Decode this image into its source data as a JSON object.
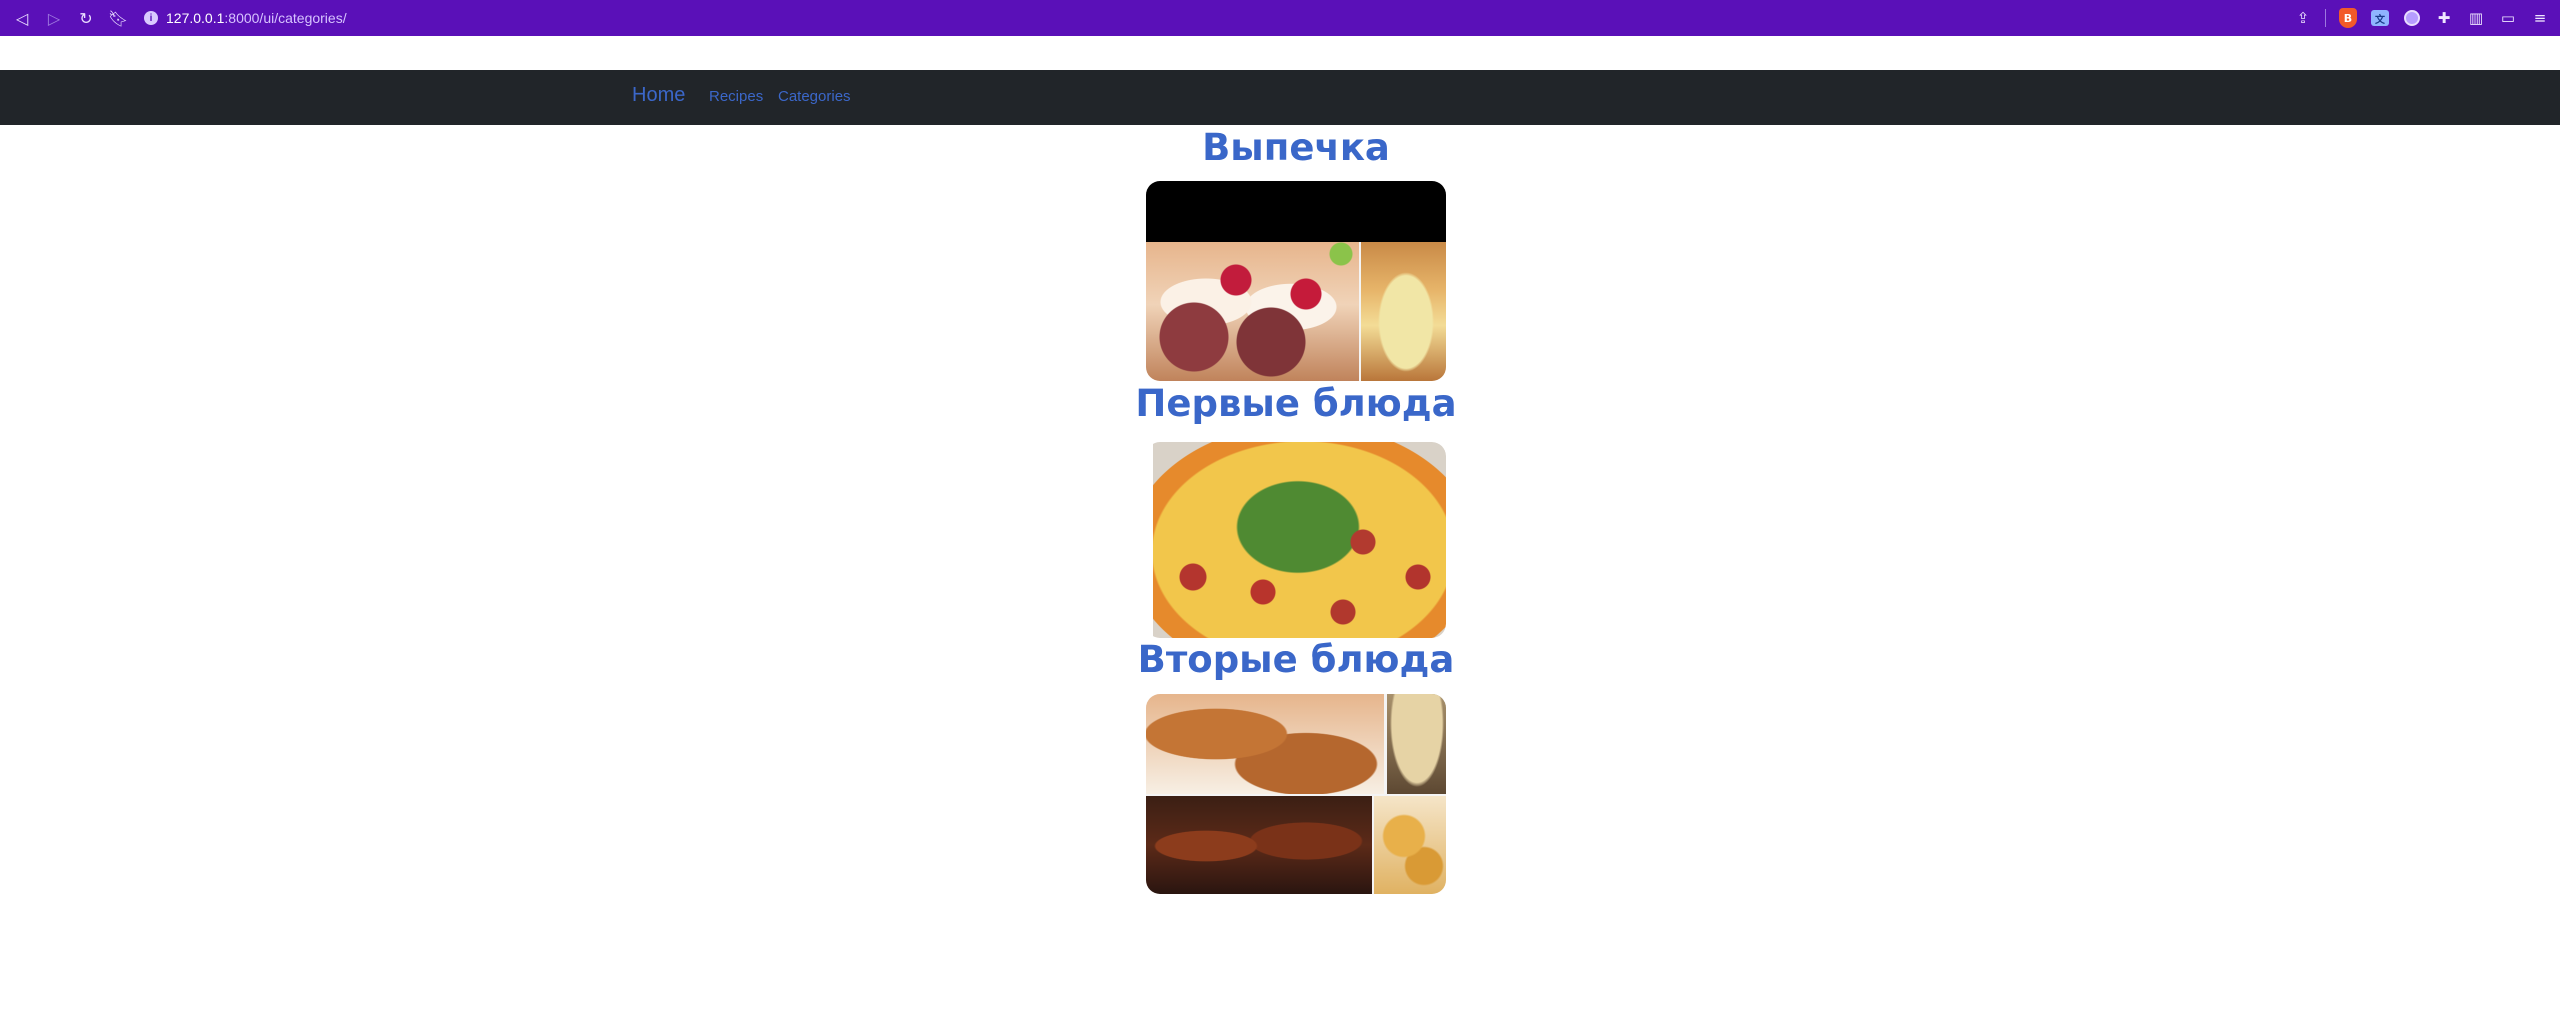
{
  "browser": {
    "url_host": "127.0.0.1",
    "url_path": ":8000/ui/categories/",
    "icons": [
      "back-icon",
      "forward-icon",
      "reload-icon",
      "bookmark-icon",
      "site-info-icon",
      "share-icon",
      "brave-shield-icon",
      "translate-icon",
      "vpn-icon",
      "extensions-icon",
      "sidebar-icon",
      "wallet-icon",
      "menu-icon"
    ]
  },
  "navbar": {
    "brand": "Home",
    "links": [
      "Recipes",
      "Categories"
    ]
  },
  "categories": [
    {
      "title": "Выпечка"
    },
    {
      "title": "Первые блюда"
    },
    {
      "title": "Вторые блюда"
    }
  ],
  "colors": {
    "browser_bar": "#5a10b8",
    "navbar_bg": "#212529",
    "link": "#3b67c9",
    "category_title": "#3a67c9"
  }
}
